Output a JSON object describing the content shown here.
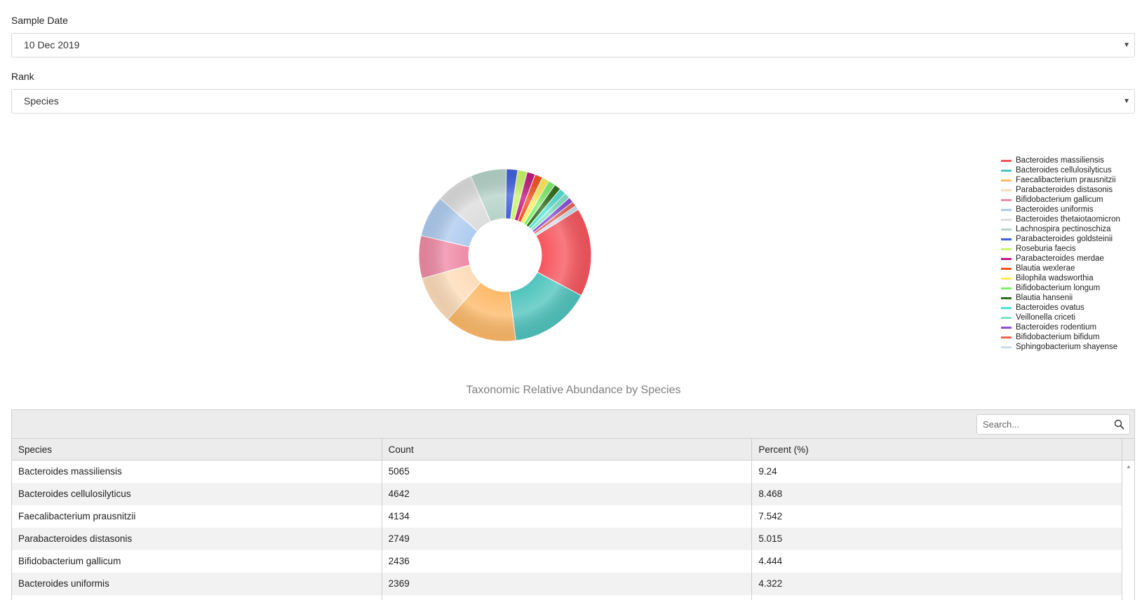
{
  "filters": {
    "sample_date_label": "Sample Date",
    "sample_date_value": "10 Dec 2019",
    "rank_label": "Rank",
    "rank_value": "Species"
  },
  "chart_data": {
    "type": "pie",
    "title": "Taxonomic Relative Abundance by Species",
    "legend_position": "right",
    "series": [
      {
        "name": "Bacteroides massiliensis",
        "value": 5065,
        "color": "#f7555d"
      },
      {
        "name": "Bacteroides cellulosilyticus",
        "value": 4642,
        "color": "#4fc4bd"
      },
      {
        "name": "Faecalibacterium prausnitzii",
        "value": 4134,
        "color": "#fdb968"
      },
      {
        "name": "Parabacteroides distasonis",
        "value": 2749,
        "color": "#fddcb8"
      },
      {
        "name": "Bifidobacterium gallicum",
        "value": 2436,
        "color": "#ef8aa6"
      },
      {
        "name": "Bacteroides uniformis",
        "value": 2369,
        "color": "#aecbef"
      },
      {
        "name": "Bacteroides thetaiotaomicron",
        "value": 2150,
        "color": "#dcdcdc"
      },
      {
        "name": "Lachnospira pectinoschiza",
        "value": 2050,
        "color": "#b5d3c8"
      },
      {
        "name": "Parabacteroides goldsteinii",
        "value": 650,
        "color": "#3f5fdc"
      },
      {
        "name": "Roseburia faecis",
        "value": 540,
        "color": "#c8f56a"
      },
      {
        "name": "Parabacteroides merdae",
        "value": 470,
        "color": "#c21a82"
      },
      {
        "name": "Blautia wexlerae",
        "value": 440,
        "color": "#f4511e"
      },
      {
        "name": "Bilophila wadsworthia",
        "value": 420,
        "color": "#fdea5a"
      },
      {
        "name": "Bifidobacterium longum",
        "value": 400,
        "color": "#7ef06c"
      },
      {
        "name": "Blautia hansenii",
        "value": 380,
        "color": "#2f6e1b"
      },
      {
        "name": "Bacteroides ovatus",
        "value": 370,
        "color": "#52e3d4"
      },
      {
        "name": "Veillonella criceti",
        "value": 330,
        "color": "#7ee3c4"
      },
      {
        "name": "Bacteroides rodentium",
        "value": 310,
        "color": "#8a4fd6"
      },
      {
        "name": "Bifidobacterium bifidum",
        "value": 270,
        "color": "#e8664f"
      },
      {
        "name": "Sphingobacterium shayense",
        "value": 250,
        "color": "#c8dcef"
      }
    ]
  },
  "table": {
    "search_placeholder": "Search...",
    "columns": [
      "Species",
      "Count",
      "Percent (%)"
    ],
    "rows": [
      [
        "Bacteroides massiliensis",
        "5065",
        "9.24"
      ],
      [
        "Bacteroides cellulosilyticus",
        "4642",
        "8.468"
      ],
      [
        "Faecalibacterium prausnitzii",
        "4134",
        "7.542"
      ],
      [
        "Parabacteroides distasonis",
        "2749",
        "5.015"
      ],
      [
        "Bifidobacterium gallicum",
        "2436",
        "4.444"
      ],
      [
        "Bacteroides uniformis",
        "2369",
        "4.322"
      ],
      [
        "",
        "",
        ""
      ]
    ]
  }
}
